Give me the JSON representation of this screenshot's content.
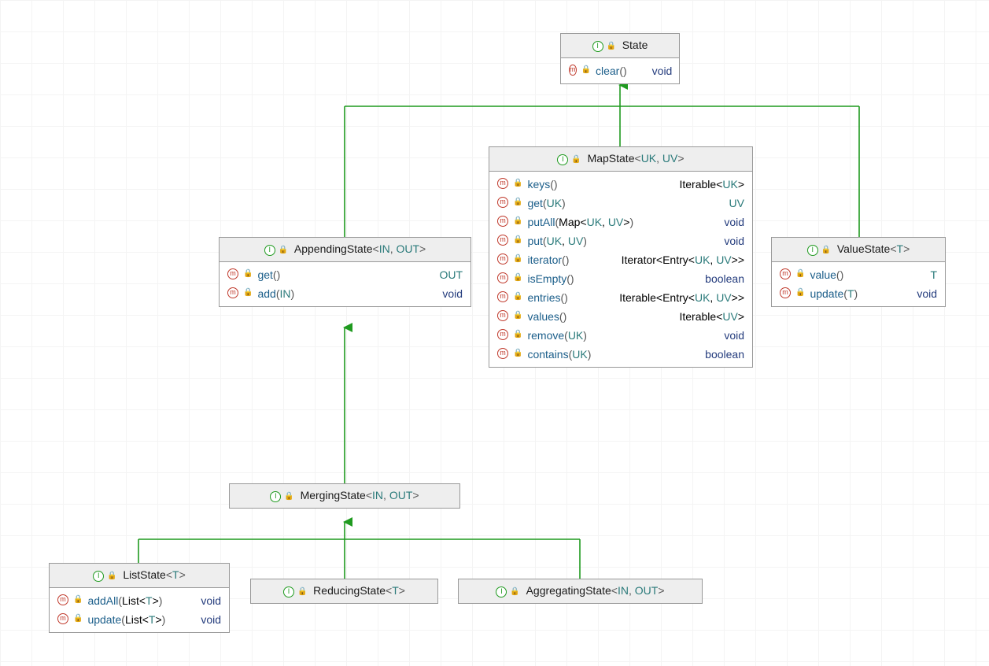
{
  "colors": {
    "connector": "#1f9a1f"
  },
  "icons": {
    "interface": "I",
    "method": "m",
    "lock": "🔒"
  },
  "classes": {
    "state": {
      "name": "State",
      "generics": [],
      "methods": [
        {
          "name": "clear",
          "params": [],
          "returns": [
            {
              "kind": "ret",
              "text": "void"
            }
          ]
        }
      ]
    },
    "appending": {
      "name": "AppendingState",
      "generics": [
        "IN",
        "OUT"
      ],
      "methods": [
        {
          "name": "get",
          "params": [],
          "returns": [
            {
              "kind": "type",
              "text": "OUT"
            }
          ]
        },
        {
          "name": "add",
          "params": [
            {
              "kind": "type",
              "text": "IN"
            }
          ],
          "returns": [
            {
              "kind": "ret",
              "text": "void"
            }
          ]
        }
      ]
    },
    "mapstate": {
      "name": "MapState",
      "generics": [
        "UK",
        "UV"
      ],
      "methods": [
        {
          "name": "keys",
          "params": [],
          "returns": [
            {
              "kind": "plain",
              "text": "Iterable<"
            },
            {
              "kind": "type",
              "text": "UK"
            },
            {
              "kind": "plain",
              "text": ">"
            }
          ]
        },
        {
          "name": "get",
          "params": [
            {
              "kind": "type",
              "text": "UK"
            }
          ],
          "returns": [
            {
              "kind": "type",
              "text": "UV"
            }
          ]
        },
        {
          "name": "putAll",
          "params": [
            {
              "kind": "plain",
              "text": "Map<"
            },
            {
              "kind": "type",
              "text": "UK"
            },
            {
              "kind": "plain",
              "text": ", "
            },
            {
              "kind": "type",
              "text": "UV"
            },
            {
              "kind": "plain",
              "text": ">"
            }
          ],
          "returns": [
            {
              "kind": "ret",
              "text": "void"
            }
          ]
        },
        {
          "name": "put",
          "params": [
            {
              "kind": "type",
              "text": "UK"
            },
            {
              "kind": "plain",
              "text": ", "
            },
            {
              "kind": "type",
              "text": "UV"
            }
          ],
          "returns": [
            {
              "kind": "ret",
              "text": "void"
            }
          ]
        },
        {
          "name": "iterator",
          "params": [],
          "returns": [
            {
              "kind": "plain",
              "text": "Iterator<Entry<"
            },
            {
              "kind": "type",
              "text": "UK"
            },
            {
              "kind": "plain",
              "text": ", "
            },
            {
              "kind": "type",
              "text": "UV"
            },
            {
              "kind": "plain",
              "text": ">>"
            }
          ],
          "tight": true
        },
        {
          "name": "isEmpty",
          "params": [],
          "returns": [
            {
              "kind": "ret",
              "text": "boolean"
            }
          ]
        },
        {
          "name": "entries",
          "params": [],
          "returns": [
            {
              "kind": "plain",
              "text": "Iterable<Entry<"
            },
            {
              "kind": "type",
              "text": "UK"
            },
            {
              "kind": "plain",
              "text": ", "
            },
            {
              "kind": "type",
              "text": "UV"
            },
            {
              "kind": "plain",
              "text": ">>"
            }
          ],
          "tight": true
        },
        {
          "name": "values",
          "params": [],
          "returns": [
            {
              "kind": "plain",
              "text": "Iterable<"
            },
            {
              "kind": "type",
              "text": "UV"
            },
            {
              "kind": "plain",
              "text": ">"
            }
          ]
        },
        {
          "name": "remove",
          "params": [
            {
              "kind": "type",
              "text": "UK"
            }
          ],
          "returns": [
            {
              "kind": "ret",
              "text": "void"
            }
          ]
        },
        {
          "name": "contains",
          "params": [
            {
              "kind": "type",
              "text": "UK"
            }
          ],
          "returns": [
            {
              "kind": "ret",
              "text": "boolean"
            }
          ]
        }
      ]
    },
    "valuestate": {
      "name": "ValueState",
      "generics": [
        "T"
      ],
      "methods": [
        {
          "name": "value",
          "params": [],
          "returns": [
            {
              "kind": "type",
              "text": "T"
            }
          ]
        },
        {
          "name": "update",
          "params": [
            {
              "kind": "type",
              "text": "T"
            }
          ],
          "returns": [
            {
              "kind": "ret",
              "text": "void"
            }
          ]
        }
      ]
    },
    "merging": {
      "name": "MergingState",
      "generics": [
        "IN",
        "OUT"
      ],
      "methods": []
    },
    "liststate": {
      "name": "ListState",
      "generics": [
        "T"
      ],
      "methods": [
        {
          "name": "addAll",
          "params": [
            {
              "kind": "plain",
              "text": "List<"
            },
            {
              "kind": "type",
              "text": "T"
            },
            {
              "kind": "plain",
              "text": ">"
            }
          ],
          "returns": [
            {
              "kind": "ret",
              "text": "void"
            }
          ]
        },
        {
          "name": "update",
          "params": [
            {
              "kind": "plain",
              "text": "List<"
            },
            {
              "kind": "type",
              "text": "T"
            },
            {
              "kind": "plain",
              "text": ">"
            }
          ],
          "returns": [
            {
              "kind": "ret",
              "text": "void"
            }
          ]
        }
      ]
    },
    "reducing": {
      "name": "ReducingState",
      "generics": [
        "T"
      ],
      "methods": []
    },
    "aggregating": {
      "name": "AggregatingState",
      "generics": [
        "IN",
        "OUT"
      ],
      "methods": []
    }
  }
}
